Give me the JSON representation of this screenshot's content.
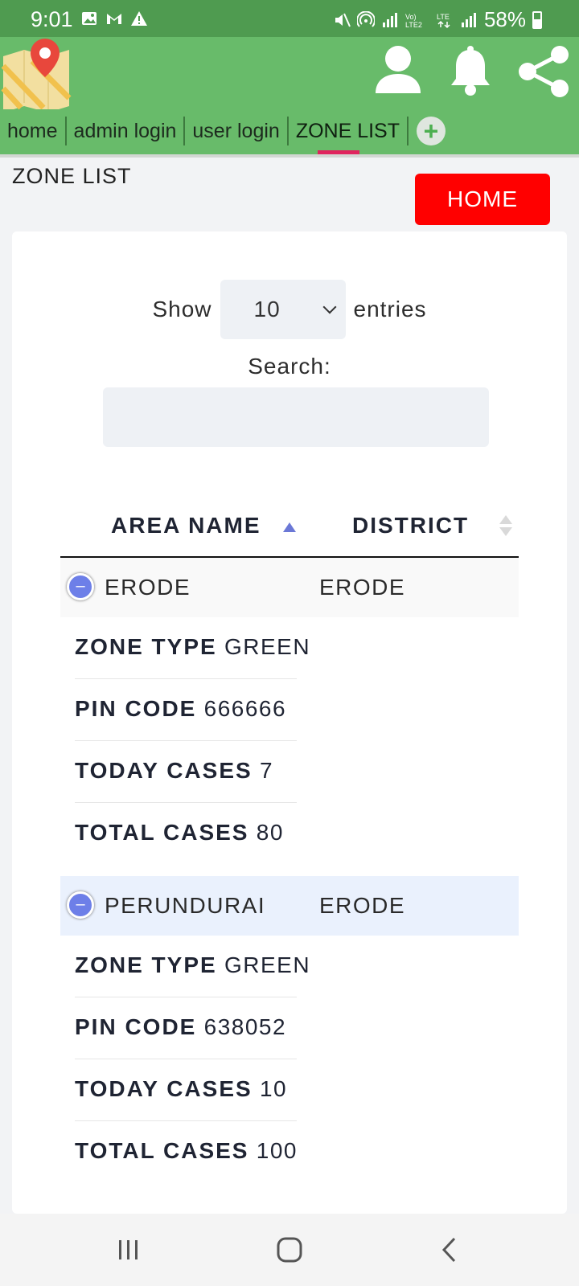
{
  "status_bar": {
    "time": "9:01",
    "network": "LTE2",
    "battery_pct": "58%"
  },
  "header": {
    "tabs": [
      {
        "label": "home"
      },
      {
        "label": "admin login"
      },
      {
        "label": "user login"
      },
      {
        "label": "ZONE LIST"
      }
    ],
    "active_tab": "ZONE LIST"
  },
  "page": {
    "title": "ZONE LIST",
    "home_button": "HOME"
  },
  "table_controls": {
    "show_label": "Show",
    "entries_value": "10",
    "entries_label": "entries",
    "search_label": "Search:",
    "search_value": ""
  },
  "table": {
    "headers": [
      "AREA NAME",
      "DISTRICT"
    ],
    "sort": {
      "column": "AREA NAME",
      "direction": "ascending"
    },
    "rows": [
      {
        "area": "ERODE",
        "district": "ERODE",
        "toggle": "–",
        "details": [
          {
            "key": "ZONE TYPE",
            "value": "GREEN"
          },
          {
            "key": "PIN CODE",
            "value": "666666"
          },
          {
            "key": "TODAY CASES",
            "value": "7"
          },
          {
            "key": "TOTAL CASES",
            "value": "80"
          }
        ]
      },
      {
        "area": "PERUNDURAI",
        "district": "ERODE",
        "toggle": "–",
        "details": [
          {
            "key": "ZONE TYPE",
            "value": "GREEN"
          },
          {
            "key": "PIN CODE",
            "value": "638052"
          },
          {
            "key": "TODAY CASES",
            "value": "10"
          },
          {
            "key": "TOTAL CASES",
            "value": "100"
          }
        ]
      }
    ]
  },
  "colors": {
    "status_bar": "#4f9b50",
    "header": "#68bb6a",
    "active_tab_indicator": "#e0245e",
    "home_button": "#ff0000",
    "row_toggle": "#6d7fe8",
    "row1_bg": "#f9f9f9",
    "row2_bg": "#eaf1fd"
  },
  "icons": {
    "header": [
      "map-logo-icon",
      "user-icon",
      "bell-icon",
      "share-icon"
    ],
    "status_left": [
      "image-icon",
      "gmail-icon",
      "warning-icon"
    ],
    "status_right": [
      "mute-icon",
      "hotspot-icon",
      "signal-icon",
      "volte-icon",
      "lte-icon",
      "signal-icon",
      "battery-icon"
    ],
    "system_nav": [
      "recents-icon",
      "home-circle-icon",
      "back-icon"
    ]
  }
}
